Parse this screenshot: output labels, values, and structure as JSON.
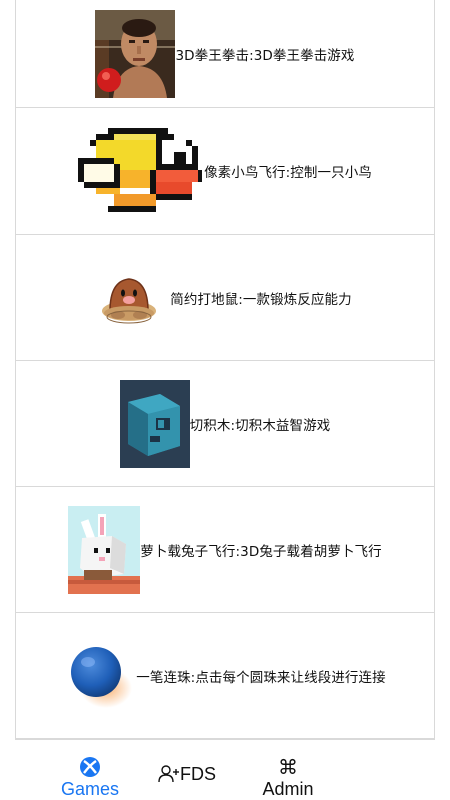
{
  "games": [
    {
      "title": "3D拳王拳击:3D拳王拳击游戏",
      "icon": "boxer-portrait-icon"
    },
    {
      "title": "像素小鸟飞行:控制一只小鸟",
      "icon": "pixel-bird-icon"
    },
    {
      "title": "简约打地鼠:一款锻炼反应能力",
      "icon": "mole-icon"
    },
    {
      "title": "切积木:切积木益智游戏",
      "icon": "blue-cube-icon"
    },
    {
      "title": "萝卜载兔子飞行:3D兔子载着胡萝卜飞行",
      "icon": "bunny-cube-icon"
    },
    {
      "title": "一笔连珠:点击每个圆珠来让线段进行连接",
      "icon": "blue-ball-icon"
    }
  ],
  "nav": {
    "games_label": "Games",
    "fds_label": "FDS",
    "admin_label": "Admin",
    "active_color": "#1976f2"
  }
}
